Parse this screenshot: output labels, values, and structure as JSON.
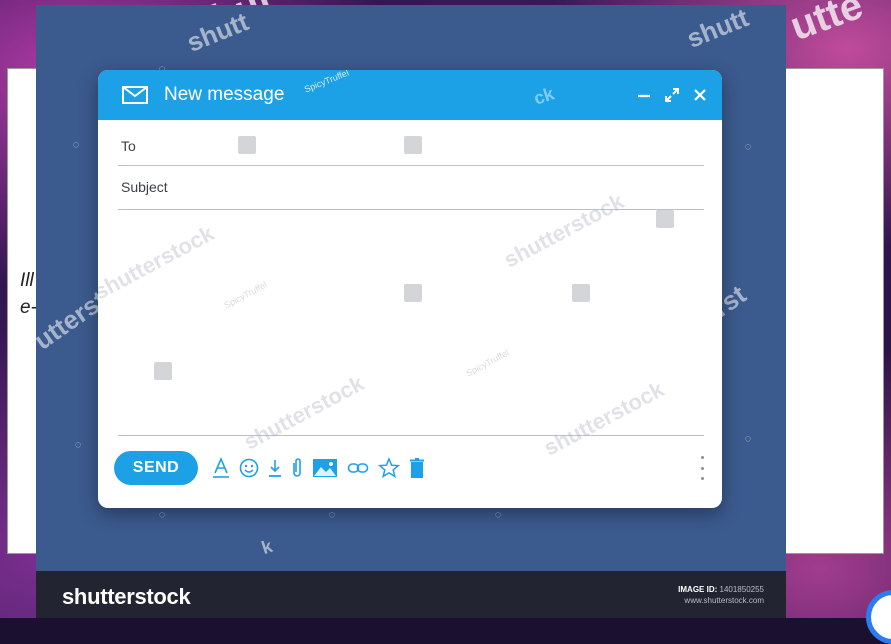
{
  "background": {
    "watermarks": [
      "shut",
      "utte"
    ]
  },
  "card": {
    "text_line1": "Ill",
    "text_line2": "e-"
  },
  "stock_panel": {
    "watermarks": [
      "shutt",
      "shutt",
      "utterst",
      "tterst",
      "shutterstock",
      "k"
    ]
  },
  "compose": {
    "title": "New message",
    "tag": "SpicyTruffel",
    "header_watermark": "ck",
    "to_label": "To",
    "subject_label": "Subject",
    "body_tags": [
      "SpicyTruffel",
      "SpicyTruffel"
    ],
    "body_watermarks": [
      "shutterstock",
      "shutterstock",
      "shutterstock",
      "shutterstock"
    ],
    "send_label": "SEND",
    "toolbar_icons": [
      "text-format-icon",
      "emoji-icon",
      "download-icon",
      "attachment-icon",
      "image-icon",
      "link-icon",
      "star-icon",
      "trash-icon"
    ],
    "accent_color": "#1da1e6"
  },
  "footer": {
    "brand": "shutterstock",
    "image_id_label": "IMAGE ID:",
    "image_id_value": "1401850255",
    "site": "www.shutterstock.com"
  },
  "colors": {
    "panel": "#3b5a8d",
    "footer": "#222531"
  }
}
